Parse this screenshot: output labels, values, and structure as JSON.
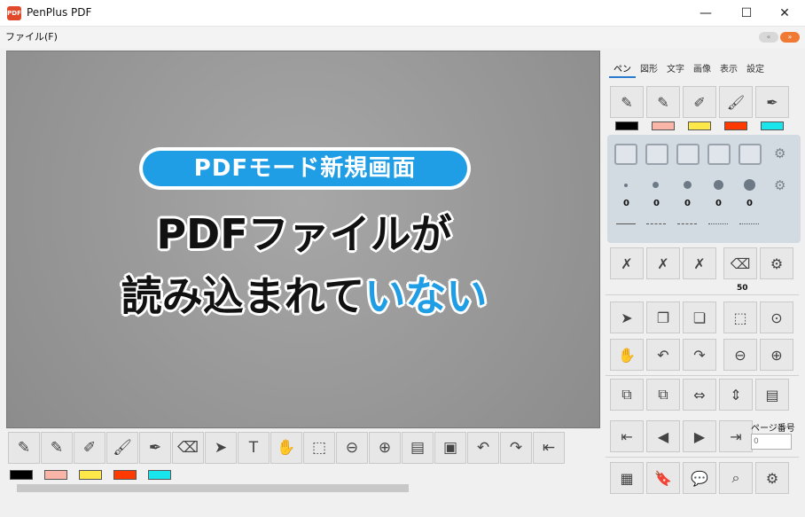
{
  "window": {
    "title": "PenPlus PDF",
    "app_icon_text": "PDF",
    "minimize_glyph": "—",
    "maximize_glyph": "☐",
    "close_glyph": "✕"
  },
  "menu": {
    "file_label": "ファイル(F)"
  },
  "nav": {
    "prev_label": "«",
    "next_label": "»"
  },
  "canvas": {
    "mode_label": "PDFモード新規画面",
    "message_line1": "PDFファイルが",
    "message_line2_black": "読み込まれて",
    "message_line2_blue": "いない"
  },
  "sidebar": {
    "tabs": [
      "ペン",
      "図形",
      "文字",
      "画像",
      "表示",
      "設定"
    ],
    "active_tab": "ペン",
    "stroke_widths": [
      "0",
      "0",
      "0",
      "0",
      "0"
    ],
    "eraser_value": "50",
    "page_number_label": "ページ番号",
    "page_number_value": "0"
  },
  "colors": {
    "swatches": [
      "#000000",
      "#f9b6a8",
      "#ffe94a",
      "#ff3a00",
      "#19e6ec"
    ],
    "accent_blue": "#1f9de5"
  },
  "toolbar_icons": [
    "pen-1-icon",
    "pen-2-icon",
    "marker-icon",
    "brush-icon",
    "text-pen-icon",
    "eraser-icon",
    "pointer-icon",
    "text-tool-icon",
    "hand-icon",
    "select-area-icon",
    "zoom-out-icon",
    "zoom-in-icon",
    "page-fit-icon",
    "insert-image-icon",
    "undo-icon",
    "redo-icon",
    "first-page-icon"
  ]
}
